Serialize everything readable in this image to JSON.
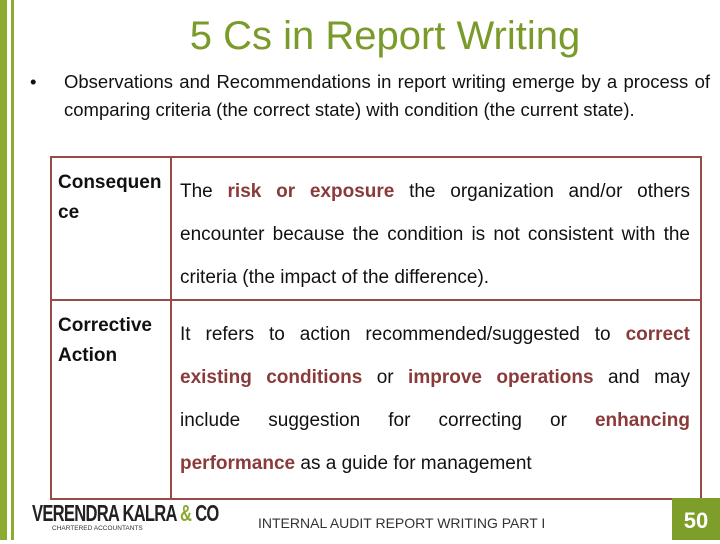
{
  "title": "5 Cs in Report Writing",
  "bullet": {
    "marker": "•",
    "text": "Observations and Recommendations in report writing emerge by a process of comparing criteria (the correct state) with condition (the current state)."
  },
  "rows": [
    {
      "term": "Consequence",
      "segments": [
        {
          "text": "The ",
          "highlight": false
        },
        {
          "text": "risk or exposure",
          "highlight": true
        },
        {
          "text": " the organization and/or others encounter because the condition is not consistent with the criteria (the impact of the difference).",
          "highlight": false
        }
      ]
    },
    {
      "term": "Corrective Action",
      "segments": [
        {
          "text": "It refers to action recommended/suggested to ",
          "highlight": false
        },
        {
          "text": "correct existing conditions",
          "highlight": true
        },
        {
          "text": " or ",
          "highlight": false
        },
        {
          "text": "improve operations",
          "highlight": true
        },
        {
          "text": " and may include suggestion for correcting or ",
          "highlight": false
        },
        {
          "text": "enhancing performance",
          "highlight": true
        },
        {
          "text": " as a guide for management",
          "highlight": false
        }
      ]
    }
  ],
  "logo": {
    "name_part1": "VERENDRA KALRA ",
    "ampersand": "&",
    "name_part2": " CO",
    "subtitle": "CHARTERED ACCOUNTANTS"
  },
  "footer": "INTERNAL AUDIT REPORT WRITING PART I",
  "page_number": "50",
  "colors": {
    "accent_green": "#8aab2e",
    "highlight_red": "#8b3a3a",
    "table_border": "#9a4a48"
  }
}
